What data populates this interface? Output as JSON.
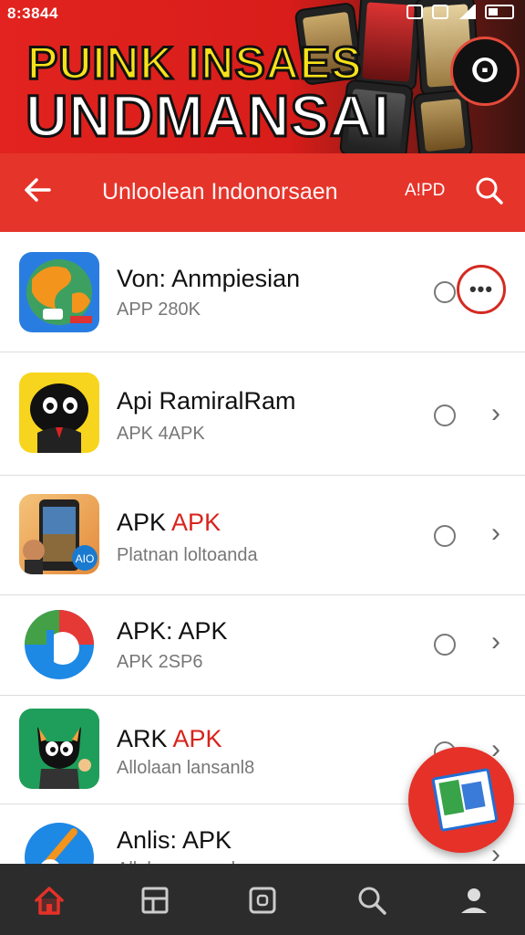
{
  "status_bar": {
    "time": "8:3844"
  },
  "banner": {
    "line1": "PUINK INSAES",
    "line2": "UNDMANSAI"
  },
  "app_bar": {
    "title": "Unloolean Indonorsaen",
    "action": "A!PD"
  },
  "apps": [
    {
      "title": "Von: Anmpiesian",
      "subtitle": "APP 280K",
      "icon": "globe-app-icon",
      "control": "more"
    },
    {
      "title": "Api RamiralRam",
      "subtitle": "APK 4APK",
      "icon": "ninja-app-icon",
      "control": "chevron"
    },
    {
      "title_parts": [
        "APK ",
        "APK"
      ],
      "subtitle": "Platnan loltoanda",
      "icon": "phone-screenshot-app-icon",
      "control": "chevron"
    },
    {
      "title": "APK: APK",
      "subtitle": "APK 2SP6",
      "icon": "colorful-d-app-icon",
      "control": "chevron"
    },
    {
      "title_parts": [
        "ARK ",
        "APK"
      ],
      "subtitle": "Allolaan lansanl8",
      "icon": "cat-character-app-icon",
      "control": "chevron"
    },
    {
      "title": "Anlis: APK",
      "subtitle": "Allolaansananlsansan",
      "icon": "blue-tool-app-icon",
      "control": "chevron"
    }
  ],
  "bottom_nav": [
    "home-icon",
    "apps-grid-icon",
    "square-icon",
    "search-icon",
    "profile-icon"
  ],
  "colors": {
    "primary": "#e5342a",
    "accent_text": "#d8231c",
    "nav_bg": "#2c2c2c"
  }
}
